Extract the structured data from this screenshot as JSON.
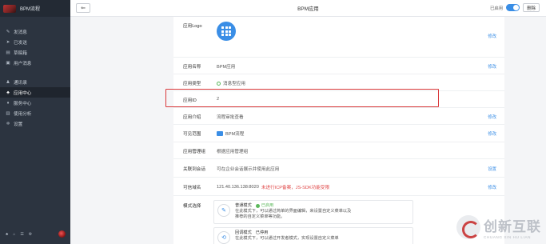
{
  "sidebar": {
    "app_title": "BPM流程",
    "group1": [
      {
        "icon": "pencil-icon",
        "glyph": "✎",
        "label": "发消息"
      },
      {
        "icon": "send-icon",
        "glyph": "➤",
        "label": "已发送"
      },
      {
        "icon": "draft-icon",
        "glyph": "▤",
        "label": "草稿箱"
      },
      {
        "icon": "user-message-icon",
        "glyph": "▣",
        "label": "用户消息"
      }
    ],
    "group2": [
      {
        "icon": "contacts-icon",
        "glyph": "♟",
        "label": "通讯录",
        "active": false
      },
      {
        "icon": "apps-icon",
        "glyph": "♣",
        "label": "应用中心",
        "active": true
      },
      {
        "icon": "service-icon",
        "glyph": "♦",
        "label": "服务中心",
        "active": false
      },
      {
        "icon": "analytics-icon",
        "glyph": "▥",
        "label": "使用分析",
        "active": false
      },
      {
        "icon": "settings-icon",
        "glyph": "✲",
        "label": "设置",
        "active": false
      }
    ],
    "footer_glyphs": [
      "♣",
      "⌂",
      "☰",
      "⚙"
    ]
  },
  "topbar": {
    "back_glyph": "⇐",
    "title": "BPM应用",
    "status": "已启用",
    "delete_label": "删除"
  },
  "rows": {
    "logo": {
      "label": "应用Logo",
      "action": "修改"
    },
    "name": {
      "label": "应用名称",
      "value": "BPM应用",
      "action": "修改"
    },
    "type": {
      "label": "应用类型",
      "value": "消息型应用"
    },
    "id": {
      "label": "应用ID",
      "value": "2"
    },
    "intro": {
      "label": "应用介绍",
      "value": "流程审批查看",
      "action": "修改"
    },
    "scope": {
      "label": "可见范围",
      "value": "BPM流程",
      "action": "修改"
    },
    "admin": {
      "label": "应用管理组",
      "value": "根据应用管理组"
    },
    "session": {
      "label": "关联到会话",
      "value": "可在企业会话展示并使用此应用",
      "action": "设置"
    },
    "domain": {
      "label": "可信域名",
      "value": "121.40.136.138:8020",
      "warning": "未进行ICP备案，JS-SDK功能受限",
      "action": "修改"
    },
    "mode": {
      "label": "模式选择",
      "cards": [
        {
          "icon": "edit-mode-icon",
          "glyph": "✎",
          "title": "普通模式",
          "status": "已启用",
          "line1": "在此模式下，可以通过简单的界面编辑，来设置自定义菜单以及",
          "line2": "推荐的自定义菜单等功能。"
        },
        {
          "icon": "callback-mode-icon",
          "glyph": "⟲",
          "title": "回调模式",
          "status": "已停用",
          "line1": "在此模式下，可以通过开发者模式，实现设置自定义菜单"
        }
      ]
    }
  },
  "watermark": {
    "cn": "创新互联",
    "en": "CHUANG XIN HU LIAN"
  },
  "colors": {
    "accent": "#3a8ee6",
    "sidebar": "#2c3440",
    "highlight": "#d9383a",
    "success": "#5cb85c",
    "warning": "#e04848"
  }
}
